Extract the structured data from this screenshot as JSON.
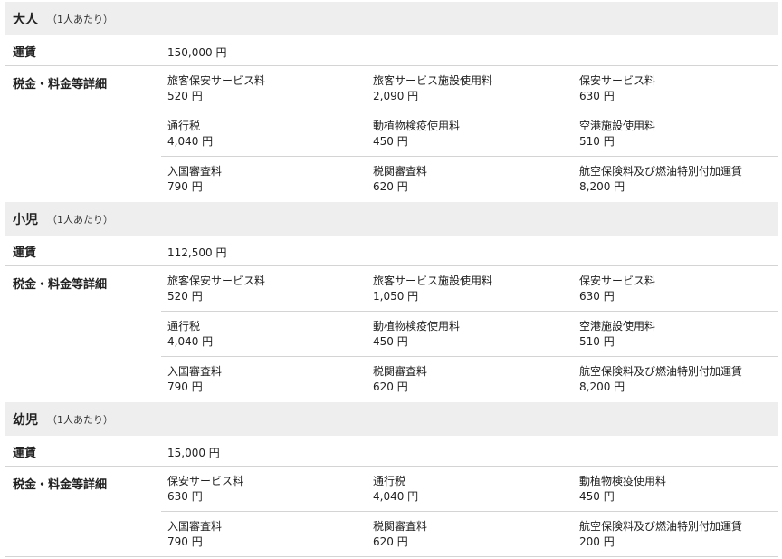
{
  "sections": [
    {
      "title": "大人",
      "note": "（1人あたり）",
      "fare_label": "運賃",
      "fare_value": "150,000 円",
      "tax_label": "税金・料金等詳細",
      "rows": [
        [
          {
            "name": "旅客保安サービス料",
            "amount": "520 円"
          },
          {
            "name": "旅客サービス施設使用料",
            "amount": "2,090 円"
          },
          {
            "name": "保安サービス料",
            "amount": "630 円"
          }
        ],
        [
          {
            "name": "通行税",
            "amount": "4,040 円"
          },
          {
            "name": "動植物検疫使用料",
            "amount": "450 円"
          },
          {
            "name": "空港施設使用料",
            "amount": "510 円"
          }
        ],
        [
          {
            "name": "入国審査料",
            "amount": "790 円"
          },
          {
            "name": "税関審査料",
            "amount": "620 円"
          },
          {
            "name": "航空保険料及び燃油特別付加運賃",
            "amount": "8,200 円"
          }
        ]
      ]
    },
    {
      "title": "小児",
      "note": "（1人あたり）",
      "fare_label": "運賃",
      "fare_value": "112,500 円",
      "tax_label": "税金・料金等詳細",
      "rows": [
        [
          {
            "name": "旅客保安サービス料",
            "amount": "520 円"
          },
          {
            "name": "旅客サービス施設使用料",
            "amount": "1,050 円"
          },
          {
            "name": "保安サービス料",
            "amount": "630 円"
          }
        ],
        [
          {
            "name": "通行税",
            "amount": "4,040 円"
          },
          {
            "name": "動植物検疫使用料",
            "amount": "450 円"
          },
          {
            "name": "空港施設使用料",
            "amount": "510 円"
          }
        ],
        [
          {
            "name": "入国審査料",
            "amount": "790 円"
          },
          {
            "name": "税関審査料",
            "amount": "620 円"
          },
          {
            "name": "航空保険料及び燃油特別付加運賃",
            "amount": "8,200 円"
          }
        ]
      ]
    },
    {
      "title": "幼児",
      "note": "（1人あたり）",
      "fare_label": "運賃",
      "fare_value": "15,000 円",
      "tax_label": "税金・料金等詳細",
      "rows": [
        [
          {
            "name": "保安サービス料",
            "amount": "630 円"
          },
          {
            "name": "通行税",
            "amount": "4,040 円"
          },
          {
            "name": "動植物検疫使用料",
            "amount": "450 円"
          }
        ],
        [
          {
            "name": "入国審査料",
            "amount": "790 円"
          },
          {
            "name": "税関審査料",
            "amount": "620 円"
          },
          {
            "name": "航空保険料及び燃油特別付加運賃",
            "amount": "200 円"
          }
        ]
      ]
    }
  ]
}
